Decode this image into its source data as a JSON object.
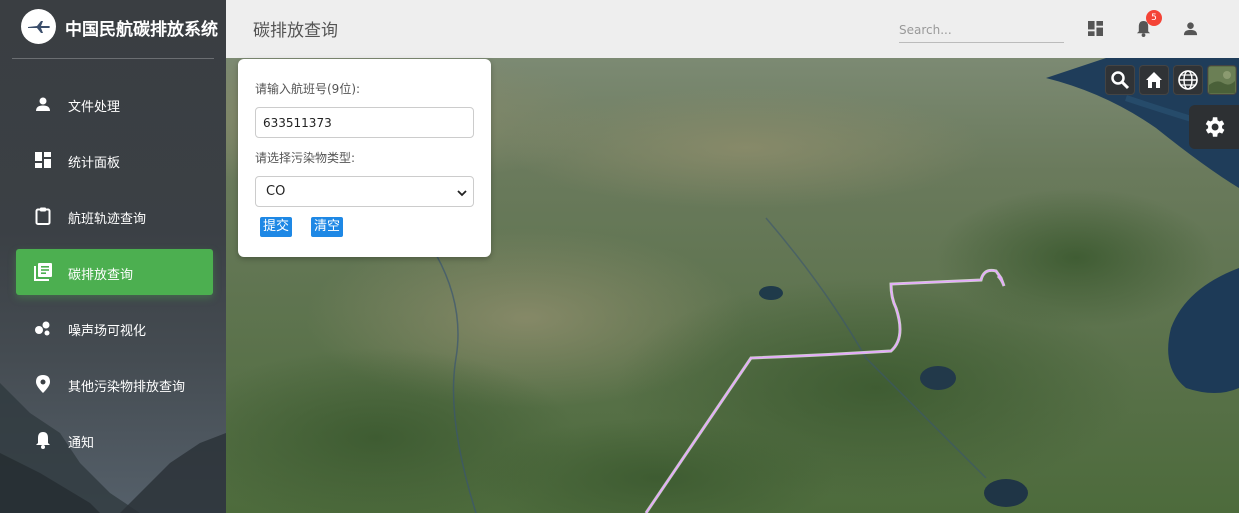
{
  "app": {
    "title": "中国民航碳排放系统",
    "logo_icon": "airplane-logo"
  },
  "sidebar": {
    "items": [
      {
        "label": "文件处理",
        "icon": "person-icon",
        "active": false
      },
      {
        "label": "统计面板",
        "icon": "dashboard-icon",
        "active": false
      },
      {
        "label": "航班轨迹查询",
        "icon": "clipboard-icon",
        "active": false
      },
      {
        "label": "碳排放查询",
        "icon": "library-books-icon",
        "active": true
      },
      {
        "label": "噪声场可视化",
        "icon": "bubble-chart-icon",
        "active": false
      },
      {
        "label": "其他污染物排放查询",
        "icon": "location-pin-icon",
        "active": false
      },
      {
        "label": "通知",
        "icon": "bell-icon",
        "active": false
      }
    ],
    "active_color": "#4caf50"
  },
  "header": {
    "page_title": "碳排放查询",
    "search_placeholder": "Search...",
    "notification_count": "5"
  },
  "query_form": {
    "flight_label": "请输入航班号(9位):",
    "flight_value": "633511373",
    "pollutant_label": "请选择污染物类型:",
    "pollutant_selected": "CO",
    "submit_label": "提交",
    "clear_label": "清空"
  },
  "map": {
    "tools": [
      "search-icon",
      "home-icon",
      "globe-icon",
      "imagery-icon",
      "settings-icon"
    ],
    "track_color": "#e6a7ff"
  }
}
